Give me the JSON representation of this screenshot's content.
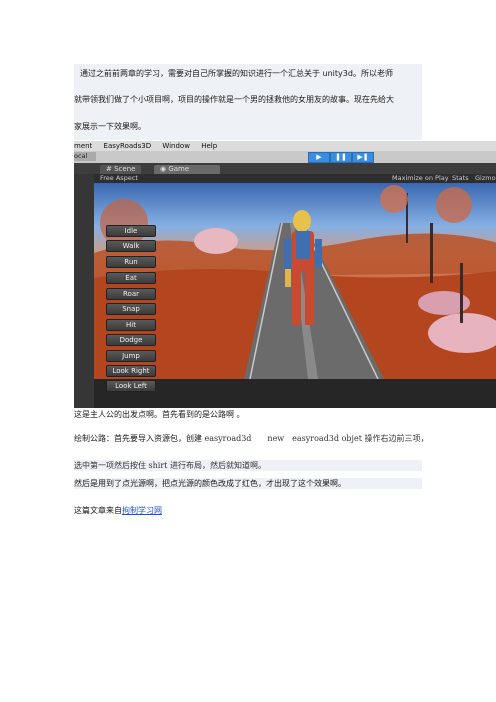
{
  "intro": {
    "line1": "通过之前前两章的学习，需要对自己所掌握的知识进行一个汇总关于 unity3d。所以老师",
    "line2": "就带领我们做了个小项目啊，项目的操作就是一个男的拯救他的女朋友的故事。现在先给大",
    "line3": "家展示一下效果啊。"
  },
  "unity": {
    "menu": [
      "ment",
      "EasyRoads3D",
      "Window",
      "Help"
    ],
    "tabs": {
      "scene": "Scene",
      "game": "Game"
    },
    "left_label": "ocal",
    "aspect": "Free Aspect",
    "right_options": {
      "maximize": "Maximize on Play",
      "stats": "Stats",
      "gizmos": "Gizmo"
    },
    "play_controls": [
      "▶",
      "❚❚",
      "▶❚"
    ],
    "anim_buttons": [
      "Idle",
      "Walk",
      "Run",
      "Eat",
      "Roar",
      "Snap",
      "Hit",
      "Dodge",
      "Jump",
      "Look Right",
      "Look Left"
    ]
  },
  "body": {
    "p1": "这是主人公的出发点啊。首先看到的是公路啊 。",
    "p2_a": "绘制公路：首先要导入资源包，创建 ",
    "p2_b": "easyroad3d　　new　easyroad3d objet 操作右边前三项，",
    "p3": "选中第一项然后按住 shirt 进行布局，然后就知道啊。",
    "p4": "然后是用到了点光源啊，把点光源的颜色改成了红色，才出现了这个效果啊。",
    "p5_prefix": "这篇文章来自",
    "p5_link": "拘制学习网"
  }
}
